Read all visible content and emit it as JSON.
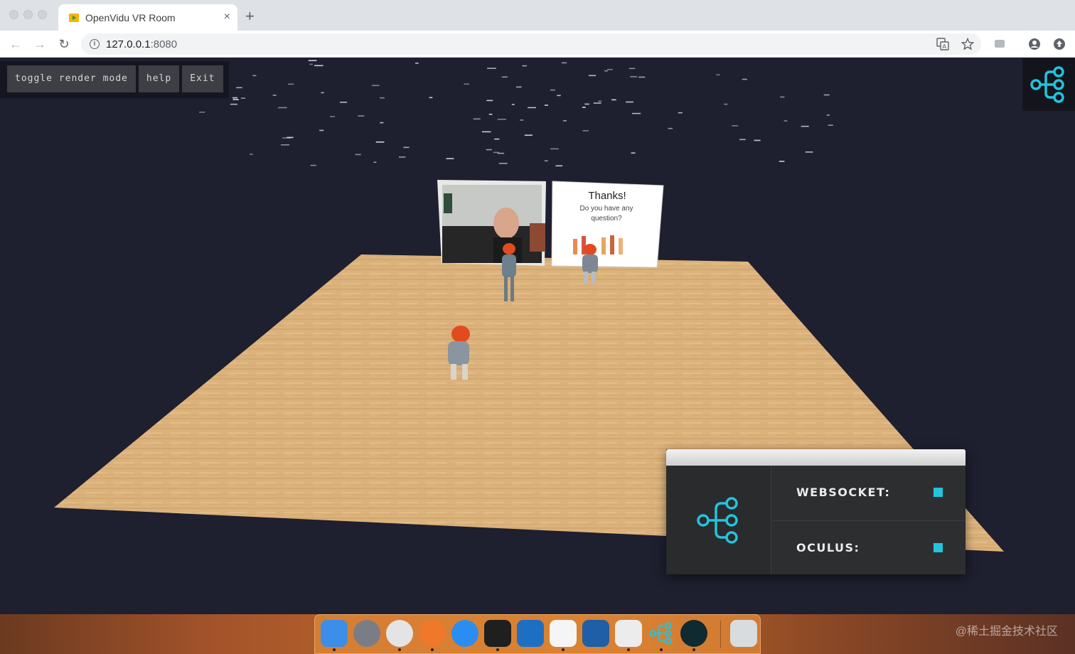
{
  "browser": {
    "tab_title": "OpenVidu VR Room",
    "tab_close": "×",
    "new_tab": "+",
    "url_host": "127.0.0.1",
    "url_port": ":8080",
    "back_icon": "←",
    "forward_icon": "→",
    "reload_icon": "↻"
  },
  "vr_controls": {
    "toggle_render_label": "toggle render mode",
    "help_label": "help",
    "exit_label": "Exit"
  },
  "slide": {
    "heading": "Thanks!",
    "line1": "Do you have any",
    "line2": "question?"
  },
  "status_panel": {
    "websocket_label": "WEBSOCKET:",
    "oculus_label": "OCULUS:",
    "indicator_color": "#24c3dd"
  },
  "colors": {
    "accent": "#24c3dd",
    "scene_background": "#1e1f2f",
    "floor": "#dcb27c"
  },
  "dock": {
    "items": [
      "finder-icon",
      "launchpad-icon",
      "chrome-icon",
      "firefox-icon",
      "safari-icon",
      "terminal-icon",
      "wireshark-icon",
      "textedit-icon",
      "vscode-icon",
      "xcode-icon",
      "openvidu-icon",
      "gitkraken-icon",
      "trash-icon"
    ]
  },
  "watermark": "@稀土掘金技术社区"
}
